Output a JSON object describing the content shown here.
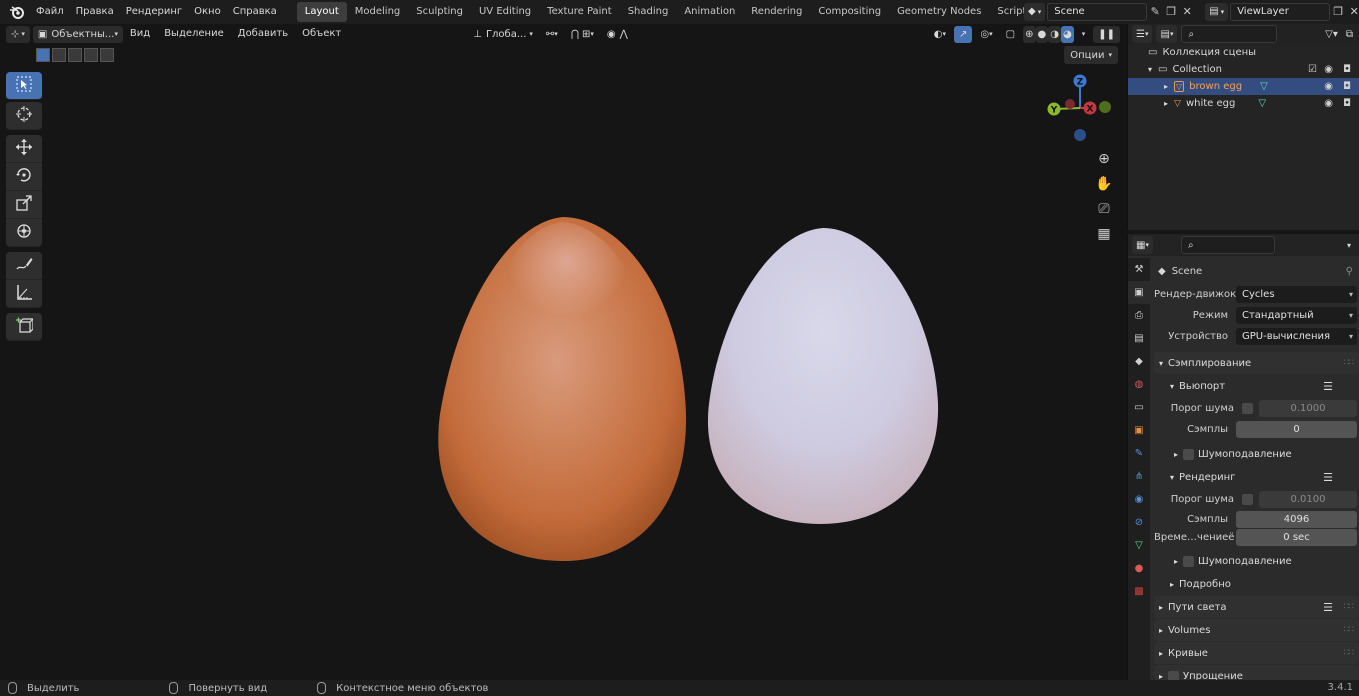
{
  "topbar": {
    "menus": [
      "Файл",
      "Правка",
      "Рендеринг",
      "Окно",
      "Справка"
    ],
    "workspaces": [
      "Layout",
      "Modeling",
      "Sculpting",
      "UV Editing",
      "Texture Paint",
      "Shading",
      "Animation",
      "Rendering",
      "Compositing",
      "Geometry Nodes",
      "Scripting"
    ],
    "active_workspace": "Layout",
    "scene_name": "Scene",
    "view_layer": "ViewLayer"
  },
  "viewport": {
    "mode": "Объектны...",
    "menus": [
      "Вид",
      "Выделение",
      "Добавить",
      "Объект"
    ],
    "orientation": "Глоба...",
    "options_label": "Опции",
    "gizmo": {
      "z": "Z",
      "y": "Y",
      "x": "X"
    },
    "objects": [
      {
        "name": "brown egg",
        "color": "#c9784a"
      },
      {
        "name": "white egg",
        "color": "#cfc9dc"
      }
    ]
  },
  "outliner": {
    "collection_label": "Коллекция сцены",
    "collection": "Collection",
    "items": [
      {
        "label": "brown egg",
        "selected": true
      },
      {
        "label": "white egg",
        "selected": false
      }
    ]
  },
  "properties": {
    "scene_label": "Scene",
    "engine_label": "Рендер-движок",
    "engine": "Cycles",
    "mode_label": "Режим",
    "mode": "Стандартный",
    "device_label": "Устройство",
    "device": "GPU-вычисления",
    "sampling": "Сэмплирование",
    "viewport_label": "Вьюпорт",
    "noise_threshold_label": "Порог шума",
    "viewport_noise": "0.1000",
    "samples_label": "Сэмплы",
    "viewport_samples": "0",
    "denoise_label": "Шумоподавление",
    "render_label": "Рендеринг",
    "render_noise": "0.0100",
    "render_samples": "4096",
    "time_limit_label": "Време…чениеё",
    "time_limit": "0 sec",
    "advanced_label": "Подробно",
    "light_paths": "Пути света",
    "volumes": "Volumes",
    "curves": "Кривые",
    "simplify": "Упрощение"
  },
  "statusbar": {
    "select": "Выделить",
    "rotate": "Повернуть вид",
    "context": "Контекстное меню объектов",
    "version": "3.4.1"
  },
  "colors": {
    "accent": "#4772b3",
    "selected_row": "#334d80",
    "x_axis": "#c6373e",
    "y_axis": "#8bb829",
    "z_axis": "#3c7ad2"
  }
}
